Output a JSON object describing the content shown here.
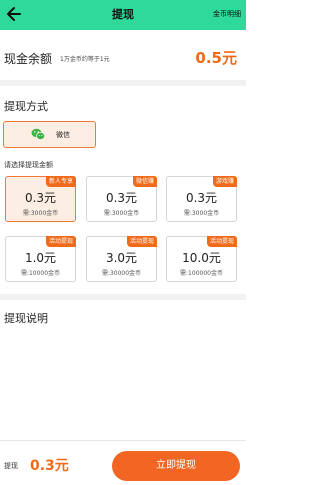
{
  "header": {
    "back_icon": "arrow-left-icon",
    "title": "提现",
    "right_link": "金币明细"
  },
  "balance": {
    "label": "现金余额",
    "note": "1万金币约等于1元",
    "value": "0.5元"
  },
  "method": {
    "title": "提现方式",
    "option": {
      "icon": "wechat-icon",
      "label": "微信"
    }
  },
  "amounts": {
    "title": "请选择提现金额",
    "items": [
      {
        "value": "0.3元",
        "condition": "需:3000金币",
        "badge": "新人专享",
        "selected": true
      },
      {
        "value": "0.3元",
        "condition": "需:3000金币",
        "badge": "微信赚",
        "selected": false
      },
      {
        "value": "0.3元",
        "condition": "需:3000金币",
        "badge": "游戏赚",
        "selected": false
      },
      {
        "value": "1.0元",
        "condition": "需:10000金币",
        "badge": "活动提现",
        "selected": false
      },
      {
        "value": "3.0元",
        "condition": "需:30000金币",
        "badge": "活动提现",
        "selected": false
      },
      {
        "value": "10.0元",
        "condition": "需:100000金币",
        "badge": "活动提现",
        "selected": false
      }
    ]
  },
  "description": {
    "title": "提现说明"
  },
  "footer": {
    "label": "提现",
    "value": "0.3元",
    "button_label": "立即提现"
  },
  "colors": {
    "header_bg": "#2fd99a",
    "accent": "#f06a1a",
    "selected_bg": "#fdeee4",
    "wechat_green": "#3bb54a"
  }
}
